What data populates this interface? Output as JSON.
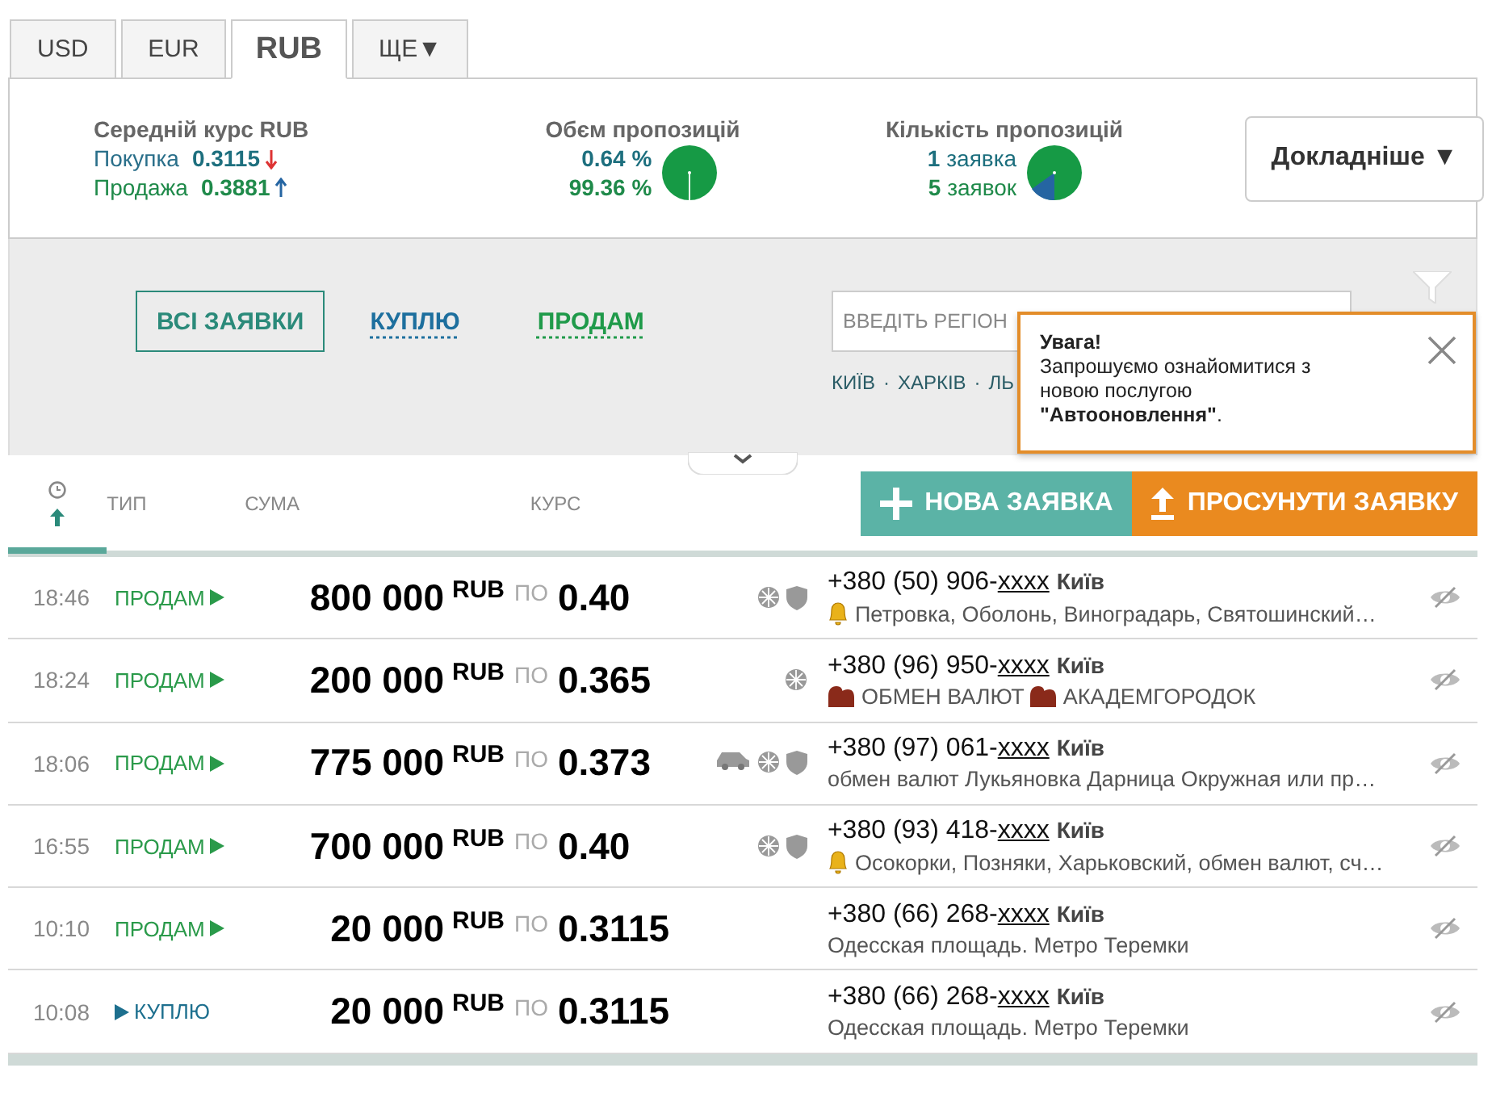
{
  "currency_tabs": [
    {
      "label": "USD",
      "selected": false
    },
    {
      "label": "EUR",
      "selected": false
    },
    {
      "label": "RUB",
      "selected": true
    },
    {
      "label": "ЩЕ▼",
      "selected": false
    }
  ],
  "summary": {
    "avg_title": "Середній курс RUB",
    "buy": {
      "label": "Покупка",
      "value": "0.3115",
      "kind": "down"
    },
    "sell": {
      "label": "Продажа",
      "value": "0.3881",
      "kind": "up"
    },
    "volume_title": "Обєм пропозицій",
    "volume_values": [
      "0.64 %",
      "99.36 %"
    ],
    "count_title": "Кількість пропозицій",
    "count_lines": [
      {
        "number": "1",
        "word": "заявка"
      },
      {
        "number": "5",
        "word": "заявок"
      }
    ],
    "details_button": "Докладніше ▼"
  },
  "filters": [
    {
      "label": "ВСІ ЗАЯВКИ",
      "kind": "all",
      "selected": true
    },
    {
      "label": "КУПЛЮ",
      "kind": "buy",
      "selected": false
    },
    {
      "label": "ПРОДАМ",
      "kind": "sell",
      "selected": false
    }
  ],
  "region": {
    "placeholder": "ВВЕДІТЬ РЕГІОН",
    "cities": [
      "КИЇВ",
      "ХАРКІВ",
      "ЛЬ"
    ],
    "separator": "·"
  },
  "popup": {
    "title": "Увага!",
    "text": "Запрошуємо ознайомитися з новою послугою **\"Автооновлення\"**."
  },
  "columns": {
    "type": "ТИП",
    "sum": "СУМА",
    "rate": "КУРС"
  },
  "actions": {
    "new": "НОВА ЗАЯВКА",
    "promote": "ПРОСУНУТИ ЗАЯВКУ"
  },
  "rows": [
    {
      "time": "18:46",
      "kind": "sell",
      "side_label": "ПРОДАМ",
      "amount": "800 000",
      "currency": "RUB",
      "per": "ПО",
      "rate": "0.40",
      "badges": [
        {
          "kind": "ball"
        },
        {
          "kind": "shield"
        }
      ],
      "phone": "+380 (50) 906-",
      "hidden": "xxxx",
      "city": "Київ",
      "note": [
        {
          "kind": "bell"
        },
        {
          "kind": "text",
          "text": "Петровка, Оболонь, Виноградарь, Святошинский…"
        }
      ]
    },
    {
      "time": "18:24",
      "kind": "sell",
      "side_label": "ПРОДАМ",
      "amount": "200 000",
      "currency": "RUB",
      "per": "ПО",
      "rate": "0.365",
      "badges": [
        {
          "kind": "ball"
        }
      ],
      "phone": "+380 (96) 950-",
      "hidden": "xxxx",
      "city": "Київ",
      "note": [
        {
          "kind": "figures"
        },
        {
          "kind": "text",
          "text": "ОБМЕН ВАЛЮТ"
        },
        {
          "kind": "figures"
        },
        {
          "kind": "text",
          "text": "АКАДЕМГОРОДОК"
        }
      ]
    },
    {
      "time": "18:06",
      "kind": "sell",
      "side_label": "ПРОДАМ",
      "amount": "775 000",
      "currency": "RUB",
      "per": "ПО",
      "rate": "0.373",
      "badges": [
        {
          "kind": "car"
        },
        {
          "kind": "ball"
        },
        {
          "kind": "shield"
        }
      ],
      "phone": "+380 (97) 061-",
      "hidden": "xxxx",
      "city": "Київ",
      "note": [
        {
          "kind": "text",
          "text": "обмен валют Лукьяновка Дарница Окружная или пр…"
        }
      ]
    },
    {
      "time": "16:55",
      "kind": "sell",
      "side_label": "ПРОДАМ",
      "amount": "700 000",
      "currency": "RUB",
      "per": "ПО",
      "rate": "0.40",
      "badges": [
        {
          "kind": "ball"
        },
        {
          "kind": "shield"
        }
      ],
      "phone": "+380 (93) 418-",
      "hidden": "xxxx",
      "city": "Київ",
      "note": [
        {
          "kind": "bell"
        },
        {
          "kind": "text",
          "text": "Осокорки, Позняки, Харьковский, обмен валют, сч…"
        }
      ]
    },
    {
      "time": "10:10",
      "kind": "sell",
      "side_label": "ПРОДАМ",
      "amount": "20 000",
      "currency": "RUB",
      "per": "ПО",
      "rate": "0.3115",
      "badges": [],
      "phone": "+380 (66) 268-",
      "hidden": "xxxx",
      "city": "Київ",
      "note": [
        {
          "kind": "text",
          "text": "Одесская площадь. Метро Теремки"
        }
      ]
    },
    {
      "time": "10:08",
      "kind": "buy",
      "side_label": "КУПЛЮ",
      "amount": "20 000",
      "currency": "RUB",
      "per": "ПО",
      "rate": "0.3115",
      "badges": [],
      "phone": "+380 (66) 268-",
      "hidden": "xxxx",
      "city": "Київ",
      "note": [
        {
          "kind": "text",
          "text": "Одесская площадь. Метро Теремки"
        }
      ]
    }
  ]
}
